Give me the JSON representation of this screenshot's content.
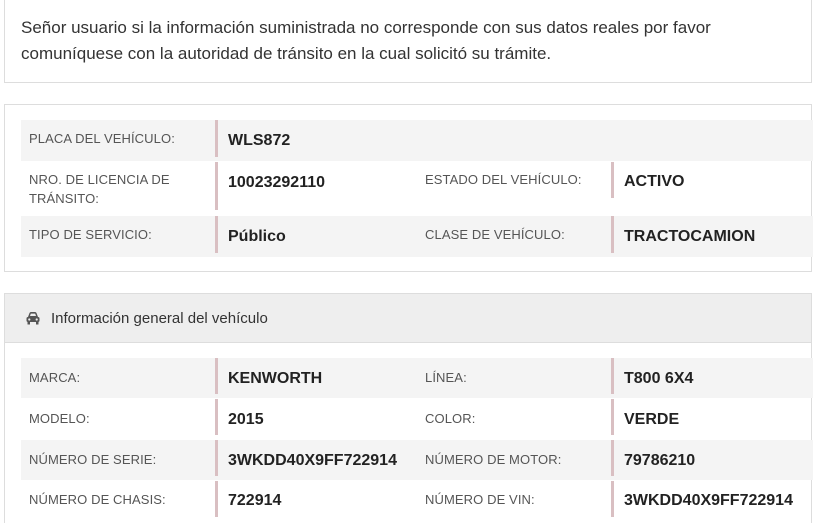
{
  "notice": {
    "text": "Señor usuario si la información suministrada no corresponde con sus datos reales por favor comuníquese con la autoridad de tránsito en la cual solicitó su trámite."
  },
  "registro": {
    "placa_label": "PLACA DEL VEHÍCULO:",
    "placa_value": "WLS872",
    "licencia_label": "NRO. DE LICENCIA DE TRÁNSITO:",
    "licencia_value": "10023292110",
    "estado_label": "ESTADO DEL VEHÍCULO:",
    "estado_value": "ACTIVO",
    "servicio_label": "TIPO DE SERVICIO:",
    "servicio_value": "Público",
    "clase_label": "CLASE DE VEHÍCULO:",
    "clase_value": "TRACTOCAMION"
  },
  "general": {
    "title": "Información general del vehículo",
    "icon": "car-icon",
    "marca_label": "MARCA:",
    "marca_value": "KENWORTH",
    "linea_label": "LÍNEA:",
    "linea_value": "T800 6X4",
    "modelo_label": "MODELO:",
    "modelo_value": "2015",
    "color_label": "COLOR:",
    "color_value": "VERDE",
    "serie_label": "NÚMERO DE SERIE:",
    "serie_value": "3WKDD40X9FF722914",
    "motor_label": "NÚMERO DE MOTOR:",
    "motor_value": "79786210",
    "chasis_label": "NÚMERO DE CHASIS:",
    "chasis_value": "722914",
    "vin_label": "NÚMERO DE VIN:",
    "vin_value": "3WKDD40X9FF722914"
  }
}
